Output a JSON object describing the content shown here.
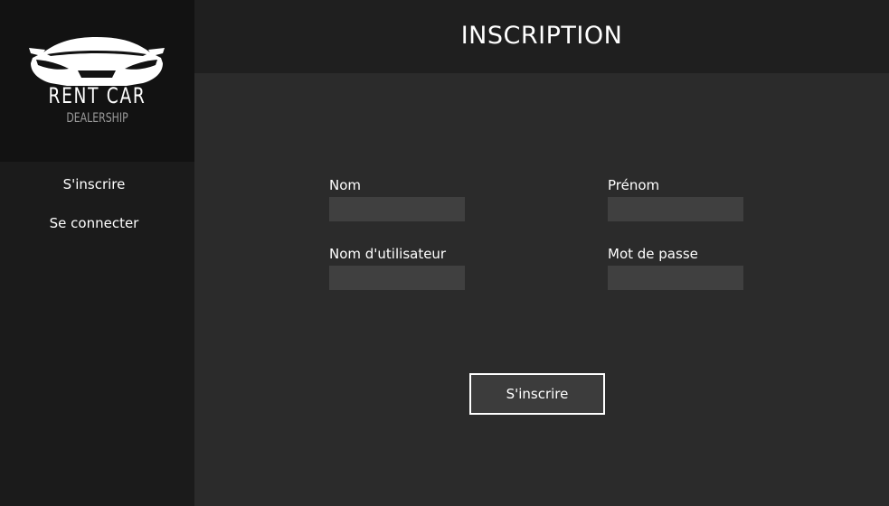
{
  "brand": {
    "title": "RENT CAR",
    "subtitle": "DEALERSHIP",
    "logo_icon": "sports-car-icon"
  },
  "sidebar": {
    "items": [
      {
        "label": "S'inscrire"
      },
      {
        "label": "Se connecter"
      }
    ]
  },
  "header": {
    "title": "INSCRIPTION"
  },
  "form": {
    "nom": {
      "label": "Nom",
      "value": ""
    },
    "prenom": {
      "label": "Prénom",
      "value": ""
    },
    "username": {
      "label": "Nom d'utilisateur",
      "value": ""
    },
    "password": {
      "label": "Mot de passe",
      "value": ""
    },
    "submit_label": "S'inscrire"
  },
  "colors": {
    "background": "#2b2b2b",
    "sidebar": "#1b1b1b",
    "logo_panel": "#121212",
    "header": "#1f1f1f",
    "input": "#404040",
    "button": "#3c3c3c",
    "text": "#ffffff"
  }
}
